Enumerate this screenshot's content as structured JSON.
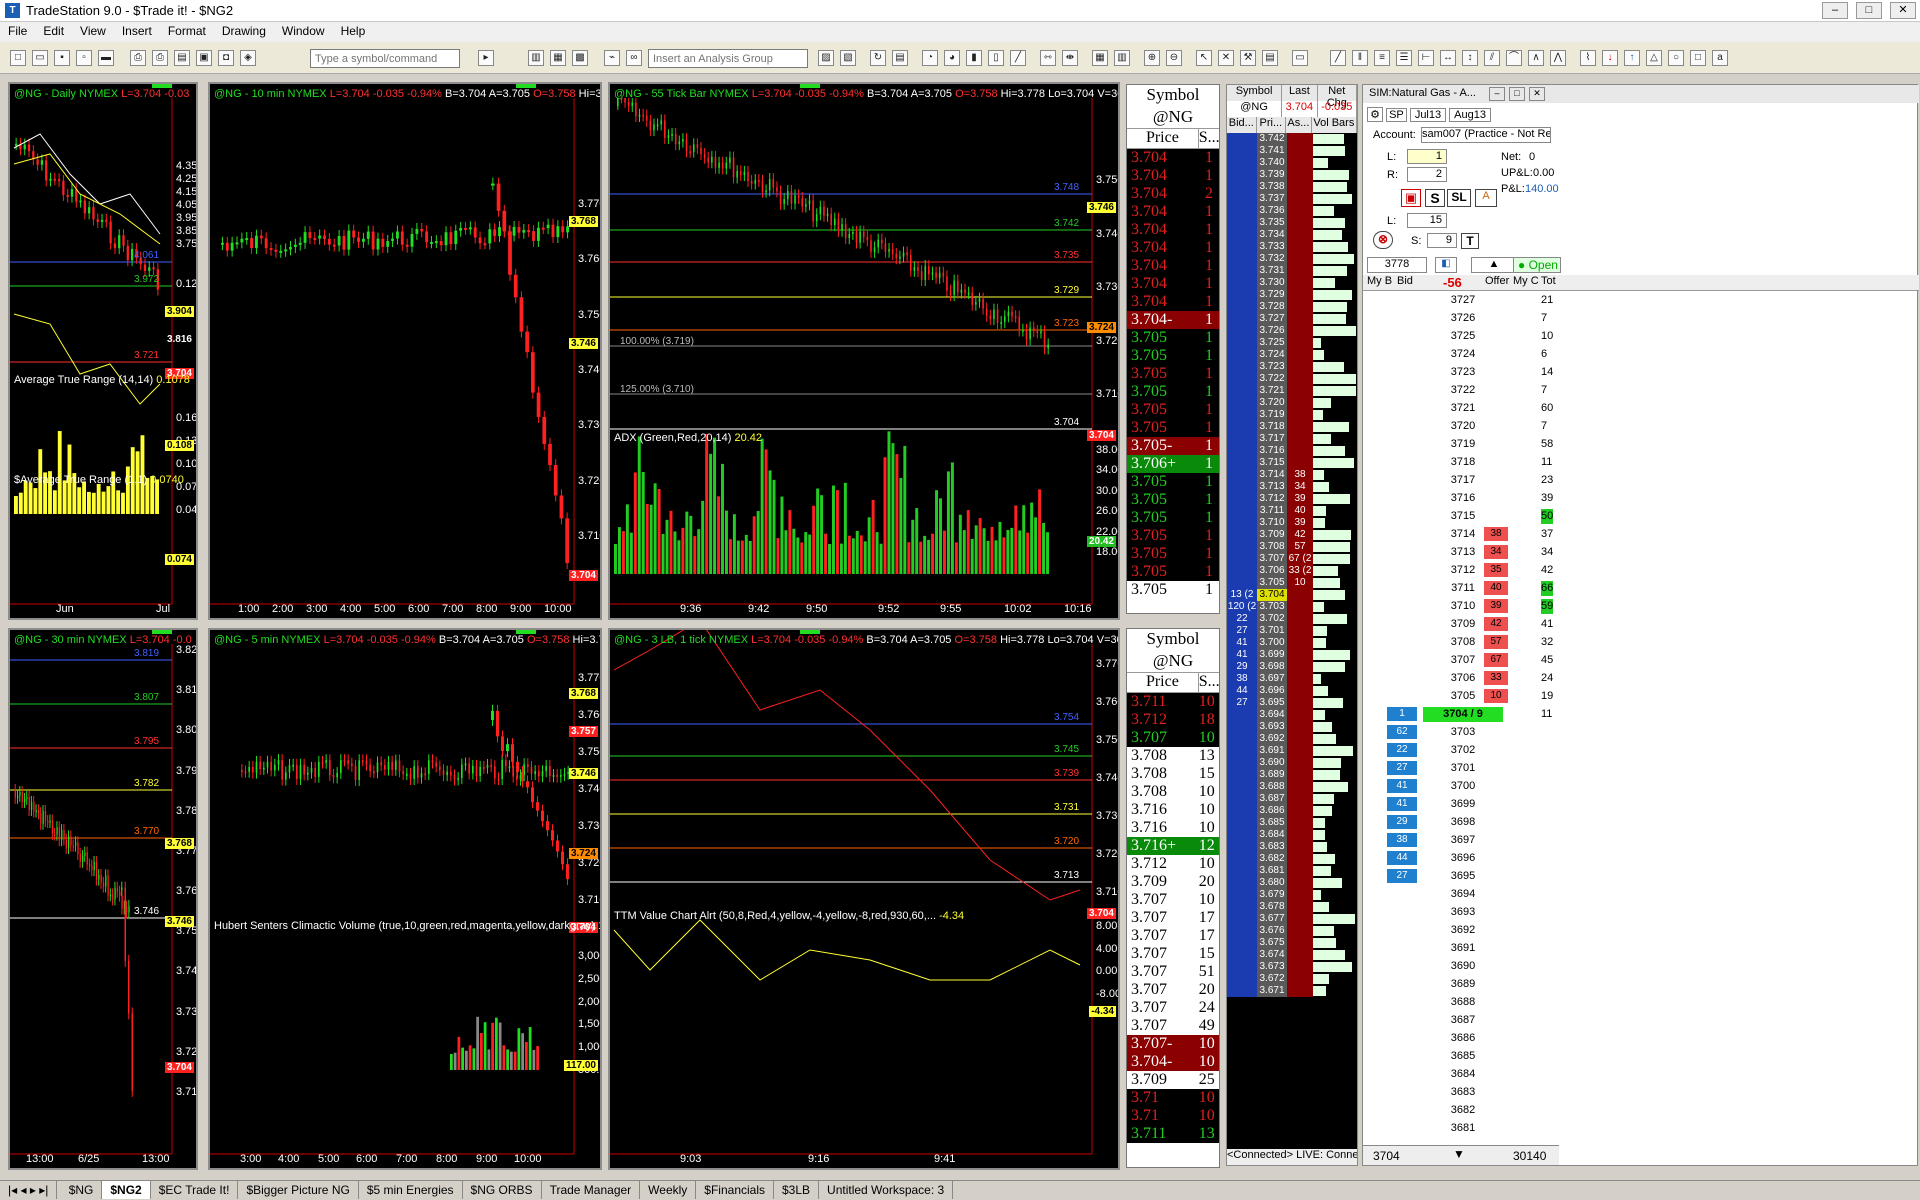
{
  "app": {
    "title": "TradeStation 9.0 - $Trade it! - $NG2"
  },
  "menu": [
    "File",
    "Edit",
    "View",
    "Insert",
    "Format",
    "Drawing",
    "Window",
    "Help"
  ],
  "toolbar": {
    "symbol_placeholder": "Type a symbol/command",
    "analysis_placeholder": "Insert an Analysis Group"
  },
  "charts": [
    {
      "id": "c1",
      "header": "@NG - Daily  NYMEX",
      "stats": [
        {
          "t": "L=3.704",
          "c": "r"
        },
        {
          "t": "-0.03",
          "c": "r"
        }
      ],
      "axis": [
        "4.350",
        "4.250",
        "4.150",
        "4.050",
        "3.950",
        "3.850",
        "3.750",
        "0.125",
        "0.160",
        "0.130",
        "0.100",
        "0.070",
        "0.040"
      ],
      "xlabels": [
        "Jun",
        "Jul"
      ],
      "tags": [
        {
          "t": "3.904",
          "c": "y"
        },
        {
          "t": "3.816",
          "c": "w"
        },
        {
          "t": "3.704",
          "c": "r"
        },
        {
          "t": "0.108",
          "c": "y"
        },
        {
          "t": "0.074",
          "c": "y"
        }
      ],
      "levels": [
        "4.061",
        "3.972",
        "3.721"
      ],
      "ind": [
        {
          "name": "Average True Range (14,14)",
          "val": "0.1078"
        },
        {
          "name": "$Average True Range (1,1)",
          "val": "0.0740"
        }
      ]
    },
    {
      "id": "c2",
      "header": "@NG - 10 min  NYMEX",
      "stats": [
        {
          "t": "L=3.704",
          "c": "r"
        },
        {
          "t": "-0.035",
          "c": "r"
        },
        {
          "t": "-0.94%",
          "c": "r"
        },
        {
          "t": "B=3.704",
          "c": "w"
        },
        {
          "t": "A=3.705",
          "c": "w"
        },
        {
          "t": "O=3.758",
          "c": "r"
        },
        {
          "t": "Hi=3.778",
          "c": "w"
        }
      ],
      "axis": [
        "3.770",
        "3.760",
        "3.750",
        "3.740",
        "3.730",
        "3.720",
        "3.710"
      ],
      "xlabels": [
        "1:00",
        "2:00",
        "3:00",
        "4:00",
        "5:00",
        "6:00",
        "7:00",
        "8:00",
        "9:00",
        "10:00"
      ],
      "tags": [
        {
          "t": "3.768",
          "c": "y"
        },
        {
          "t": "3.746",
          "c": "y"
        },
        {
          "t": "3.704",
          "c": "r"
        }
      ]
    },
    {
      "id": "c3",
      "header": "@NG - 55 Tick Bar  NYMEX",
      "stats": [
        {
          "t": "L=3.704",
          "c": "r"
        },
        {
          "t": "-0.035",
          "c": "r"
        },
        {
          "t": "-0.94%",
          "c": "r"
        },
        {
          "t": "B=3.704",
          "c": "w"
        },
        {
          "t": "A=3.705",
          "c": "w"
        },
        {
          "t": "O=3.758",
          "c": "r"
        },
        {
          "t": "Hi=3.778",
          "c": "w"
        },
        {
          "t": "Lo=3.704",
          "c": "w"
        },
        {
          "t": "V=30,140",
          "c": "w"
        },
        {
          "t": "$Cr",
          "c": "w"
        }
      ],
      "axis": [
        "3.750",
        "3.740",
        "3.730",
        "3.720",
        "3.710",
        "38.00",
        "34.00",
        "30.00",
        "26.00",
        "22.00",
        "18.00"
      ],
      "xlabels": [
        "9:36",
        "9:42",
        "9:50",
        "9:52",
        "9:55",
        "10:02",
        "10:16"
      ],
      "tags": [
        {
          "t": "3.746",
          "c": "y"
        },
        {
          "t": "3.724",
          "c": "o"
        },
        {
          "t": "3.704",
          "c": "r"
        },
        {
          "t": "20.42",
          "c": "g"
        }
      ],
      "levels": [
        "3.748",
        "3.742",
        "3.735",
        "3.729",
        "3.723",
        "3.704"
      ],
      "fibs": [
        "100.00% (3.719)",
        "125.00% (3.710)"
      ],
      "ind": [
        {
          "name": "ADX (Green,Red,20,14)",
          "val": "20.42"
        }
      ]
    },
    {
      "id": "c4",
      "header": "@NG - 30 min  NYMEX",
      "stats": [
        {
          "t": "L=3.704",
          "c": "r"
        },
        {
          "t": "-0.0",
          "c": "r"
        }
      ],
      "axis": [
        "3.820",
        "3.810",
        "3.800",
        "3.790",
        "3.780",
        "3.770",
        "3.760",
        "3.750",
        "3.740",
        "3.730",
        "3.720",
        "3.710"
      ],
      "xlabels": [
        "13:00",
        "6/25",
        "13:00"
      ],
      "tags": [
        {
          "t": "3.768",
          "c": "y"
        },
        {
          "t": "3.746",
          "c": "y"
        },
        {
          "t": "3.704",
          "c": "r"
        }
      ],
      "levels": [
        "3.819",
        "3.807",
        "3.795",
        "3.782",
        "3.770",
        "3.746"
      ]
    },
    {
      "id": "c5",
      "header": "@NG - 5 min  NYMEX",
      "stats": [
        {
          "t": "L=3.704",
          "c": "r"
        },
        {
          "t": "-0.035",
          "c": "r"
        },
        {
          "t": "-0.94%",
          "c": "r"
        },
        {
          "t": "B=3.704",
          "c": "w"
        },
        {
          "t": "A=3.705",
          "c": "w"
        },
        {
          "t": "O=3.758",
          "c": "r"
        },
        {
          "t": "Hi=3.778",
          "c": "w"
        }
      ],
      "axis": [
        "3.770",
        "3.760",
        "3.750",
        "3.740",
        "3.730",
        "3.720",
        "3.710",
        "3,000.00",
        "2,500.00",
        "2,000.00",
        "1,500.00",
        "1,000.00",
        "500.00"
      ],
      "xlabels": [
        "3:00",
        "4:00",
        "5:00",
        "6:00",
        "7:00",
        "8:00",
        "9:00",
        "10:00"
      ],
      "tags": [
        {
          "t": "3.768",
          "c": "y"
        },
        {
          "t": "3.757",
          "c": "r"
        },
        {
          "t": "3.746",
          "c": "y"
        },
        {
          "t": "3.724",
          "c": "o"
        },
        {
          "t": "3.704",
          "c": "r"
        },
        {
          "t": "117.00",
          "c": "y"
        }
      ],
      "ind": [
        {
          "name": "Hubert Senters Climactic Volume (true,10,green,red,magenta,yellow,darkgray)",
          "val": "117.00"
        }
      ]
    },
    {
      "id": "c6",
      "header": "@NG - 3 LB, 1 tick  NYMEX",
      "stats": [
        {
          "t": "L=3.704",
          "c": "r"
        },
        {
          "t": "-0.035",
          "c": "r"
        },
        {
          "t": "-0.94%",
          "c": "r"
        },
        {
          "t": "B=3.704",
          "c": "w"
        },
        {
          "t": "A=3.705",
          "c": "w"
        },
        {
          "t": "O=3.758",
          "c": "r"
        },
        {
          "t": "Hi=3.778",
          "c": "w"
        },
        {
          "t": "Lo=3.704",
          "c": "w"
        },
        {
          "t": "V=30,140",
          "c": "w"
        }
      ],
      "axis": [
        "3.770",
        "3.760",
        "3.750",
        "3.740",
        "3.730",
        "3.720",
        "3.710",
        "8.00",
        "4.00",
        "0.00",
        "-8.00"
      ],
      "xlabels": [
        "9:03",
        "9:16",
        "9:41"
      ],
      "tags": [
        {
          "t": "3.704",
          "c": "r"
        },
        {
          "t": "-4.34",
          "c": "y"
        }
      ],
      "levels": [
        "3.754",
        "3.745",
        "3.739",
        "3.731",
        "3.720",
        "3.713"
      ],
      "ind": [
        {
          "name": "TTM Value Chart Alrt (50,8,Red,4,yellow,-4,yellow,-8,red,930,60,...",
          "val": "-4.34"
        }
      ]
    }
  ],
  "ts1": {
    "symbol_hdr": "Symbol",
    "symbol": "@NG",
    "price_hdr": "Price",
    "size_hdr": "S...",
    "rows": [
      [
        "3.704",
        "1",
        "r"
      ],
      [
        "3.704",
        "1",
        "r"
      ],
      [
        "3.704",
        "2",
        "r"
      ],
      [
        "3.704",
        "1",
        "r"
      ],
      [
        "3.704",
        "1",
        "r"
      ],
      [
        "3.704",
        "1",
        "r"
      ],
      [
        "3.704",
        "1",
        "r"
      ],
      [
        "3.704",
        "1",
        "r"
      ],
      [
        "3.704",
        "1",
        "r"
      ],
      [
        "3.704-",
        "1",
        "rh"
      ],
      [
        "3.705",
        "1",
        "g"
      ],
      [
        "3.705",
        "1",
        "g"
      ],
      [
        "3.705",
        "1",
        "r"
      ],
      [
        "3.705",
        "1",
        "g"
      ],
      [
        "3.705",
        "1",
        "r"
      ],
      [
        "3.705",
        "1",
        "r"
      ],
      [
        "3.705-",
        "1",
        "rh"
      ],
      [
        "3.706+",
        "1",
        "gh"
      ],
      [
        "3.705",
        "1",
        "g"
      ],
      [
        "3.705",
        "1",
        "g"
      ],
      [
        "3.705",
        "1",
        "g"
      ],
      [
        "3.705",
        "1",
        "r"
      ],
      [
        "3.705",
        "1",
        "r"
      ],
      [
        "3.705",
        "1",
        "r"
      ],
      [
        "3.705",
        "1",
        "w"
      ]
    ]
  },
  "ts2": {
    "symbol_hdr": "Symbol",
    "symbol": "@NG",
    "price_hdr": "Price",
    "size_hdr": "S...",
    "rows": [
      [
        "3.711",
        "10",
        "r"
      ],
      [
        "3.712",
        "18",
        "r"
      ],
      [
        "3.707",
        "10",
        "g"
      ],
      [
        "3.708",
        "13",
        "w"
      ],
      [
        "3.708",
        "15",
        "w"
      ],
      [
        "3.708",
        "10",
        "w"
      ],
      [
        "3.716",
        "10",
        "w"
      ],
      [
        "3.716",
        "10",
        "w"
      ],
      [
        "3.716+",
        "12",
        "gh"
      ],
      [
        "3.712",
        "10",
        "w"
      ],
      [
        "3.709",
        "20",
        "w"
      ],
      [
        "3.707",
        "10",
        "w"
      ],
      [
        "3.707",
        "17",
        "w"
      ],
      [
        "3.707",
        "17",
        "w"
      ],
      [
        "3.707",
        "15",
        "w"
      ],
      [
        "3.707",
        "51",
        "w"
      ],
      [
        "3.707",
        "20",
        "w"
      ],
      [
        "3.707",
        "24",
        "w"
      ],
      [
        "3.707",
        "49",
        "w"
      ],
      [
        "3.707-",
        "10",
        "rh"
      ],
      [
        "3.704-",
        "10",
        "rh"
      ],
      [
        "3.709",
        "25",
        "w"
      ],
      [
        "3.71",
        "10",
        "r"
      ],
      [
        "3.71",
        "10",
        "r"
      ],
      [
        "3.711",
        "13",
        "g"
      ]
    ]
  },
  "matrix": {
    "h_symbol": "Symbol",
    "h_last": "Last",
    "h_net": "Net Chg",
    "symbol": "@NG",
    "last": "3.704",
    "net": "-0.035",
    "h_bid": "Bid...",
    "h_pri": "Pri...",
    "h_ask": "As...",
    "h_vol": "Vol Bars",
    "prices": [
      "3.742",
      "3.741",
      "3.740",
      "3.739",
      "3.738",
      "3.737",
      "3.736",
      "3.735",
      "3.734",
      "3.733",
      "3.732",
      "3.731",
      "3.730",
      "3.729",
      "3.728",
      "3.727",
      "3.726",
      "3.725",
      "3.724",
      "3.723",
      "3.722",
      "3.721",
      "3.720",
      "3.719",
      "3.718",
      "3.717",
      "3.716",
      "3.715",
      "3.714",
      "3.713",
      "3.712",
      "3.711",
      "3.710",
      "3.709",
      "3.708",
      "3.707",
      "3.706",
      "3.705",
      "3.704",
      "3.703",
      "3.702",
      "3.701",
      "3.700",
      "3.699",
      "3.698",
      "3.697",
      "3.696",
      "3.695",
      "3.694",
      "3.693",
      "3.692",
      "3.691",
      "3.690",
      "3.689",
      "3.688",
      "3.687",
      "3.686",
      "3.685",
      "3.684",
      "3.683",
      "3.682",
      "3.681",
      "3.680",
      "3.679",
      "3.678",
      "3.677",
      "3.676",
      "3.675",
      "3.674",
      "3.673",
      "3.672",
      "3.671"
    ],
    "asks": {
      "28": "38",
      "29": "34",
      "30": "39",
      "31": "40",
      "32": "39",
      "33": "42",
      "34": "57",
      "35": "67 (2",
      "36": "33 (2",
      "37": "10"
    },
    "bids": {
      "38": "13 (2",
      "39": "120 (2",
      "40": "22",
      "41": "27",
      "42": "41",
      "43": "41",
      "44": "29",
      "45": "38",
      "46": "44",
      "47": "27"
    },
    "status": "<Connected> LIVE: Connected"
  },
  "dom": {
    "title": "SIM:Natural Gas - A...",
    "sym": "SP",
    "m1": "Jul13",
    "m2": "Aug13",
    "account_lbl": "Account:",
    "account": "sam007 (Practice - Not Reviewe",
    "l_lbl": "L:",
    "l_val": "1",
    "r_lbl": "R:",
    "r_val": "2",
    "net_lbl": "Net:",
    "net": "0",
    "upl_lbl": "UP&L:",
    "upl": "0.00",
    "pl_lbl": "P&L:",
    "pl": "140.00",
    "l2_lbl": "L:",
    "l2_val": "15",
    "s_lbl": "S:",
    "s_val": "9",
    "open": "Open",
    "qty": "3778",
    "chg": "-56",
    "h_mybid": "My B",
    "h_bid": "Bid",
    "h_offer": "Offer",
    "h_myc": "My C",
    "h_tot": "Tot",
    "rows": [
      [
        "3727",
        "",
        "",
        "21"
      ],
      [
        "3726",
        "",
        "",
        "7"
      ],
      [
        "3725",
        "",
        "",
        "10"
      ],
      [
        "3724",
        "",
        "",
        "6"
      ],
      [
        "3723",
        "",
        "",
        "14"
      ],
      [
        "3722",
        "",
        "",
        "7"
      ],
      [
        "3721",
        "",
        "",
        "60"
      ],
      [
        "3720",
        "",
        "",
        "7"
      ],
      [
        "3719",
        "",
        "",
        "58"
      ],
      [
        "3718",
        "",
        "",
        "11"
      ],
      [
        "3717",
        "",
        "",
        "23"
      ],
      [
        "3716",
        "",
        "",
        "39"
      ],
      [
        "3715",
        "",
        "",
        "50"
      ],
      [
        "3714",
        "",
        "38",
        "37"
      ],
      [
        "3713",
        "",
        "34",
        "34"
      ],
      [
        "3712",
        "",
        "35",
        "42"
      ],
      [
        "3711",
        "",
        "40",
        "66"
      ],
      [
        "3710",
        "",
        "39",
        "59"
      ],
      [
        "3709",
        "",
        "42",
        "41"
      ],
      [
        "3708",
        "",
        "57",
        "32"
      ],
      [
        "3707",
        "",
        "67",
        "45"
      ],
      [
        "3706",
        "",
        "33",
        "24"
      ],
      [
        "3705",
        "",
        "10",
        "19"
      ],
      [
        "3704 / 9",
        "1",
        "",
        "11"
      ],
      [
        "3703",
        "62",
        "",
        ""
      ],
      [
        "3702",
        "22",
        "",
        ""
      ],
      [
        "3701",
        "27",
        "",
        ""
      ],
      [
        "3700",
        "41",
        "",
        ""
      ],
      [
        "3699",
        "41",
        "",
        ""
      ],
      [
        "3698",
        "29",
        "",
        ""
      ],
      [
        "3697",
        "38",
        "",
        ""
      ],
      [
        "3696",
        "44",
        "",
        ""
      ],
      [
        "3695",
        "27",
        "",
        ""
      ],
      [
        "3694",
        "",
        "",
        ""
      ],
      [
        "3693",
        "",
        "",
        ""
      ],
      [
        "3692",
        "",
        "",
        ""
      ],
      [
        "3691",
        "",
        "",
        ""
      ],
      [
        "3690",
        "",
        "",
        ""
      ],
      [
        "3689",
        "",
        "",
        ""
      ],
      [
        "3688",
        "",
        "",
        ""
      ],
      [
        "3687",
        "",
        "",
        ""
      ],
      [
        "3686",
        "",
        "",
        ""
      ],
      [
        "3685",
        "",
        "",
        ""
      ],
      [
        "3684",
        "",
        "",
        ""
      ],
      [
        "3683",
        "",
        "",
        ""
      ],
      [
        "3682",
        "",
        "",
        ""
      ],
      [
        "3681",
        "",
        "",
        ""
      ]
    ],
    "foot_l": "3704",
    "foot_r": "30140"
  },
  "tabs": [
    "$NG",
    "$NG2",
    "$EC Trade It!",
    "$Bigger Picture NG",
    "$5 min Energies",
    "$NG ORBS",
    "Trade Manager",
    "Weekly",
    "$Financials",
    "$3LB",
    "Untitled Workspace: 3"
  ],
  "colors": {
    "up": "#22dd22",
    "down": "#ff2020",
    "cyan": "#33ccdd",
    "yellow": "#ffff33"
  }
}
